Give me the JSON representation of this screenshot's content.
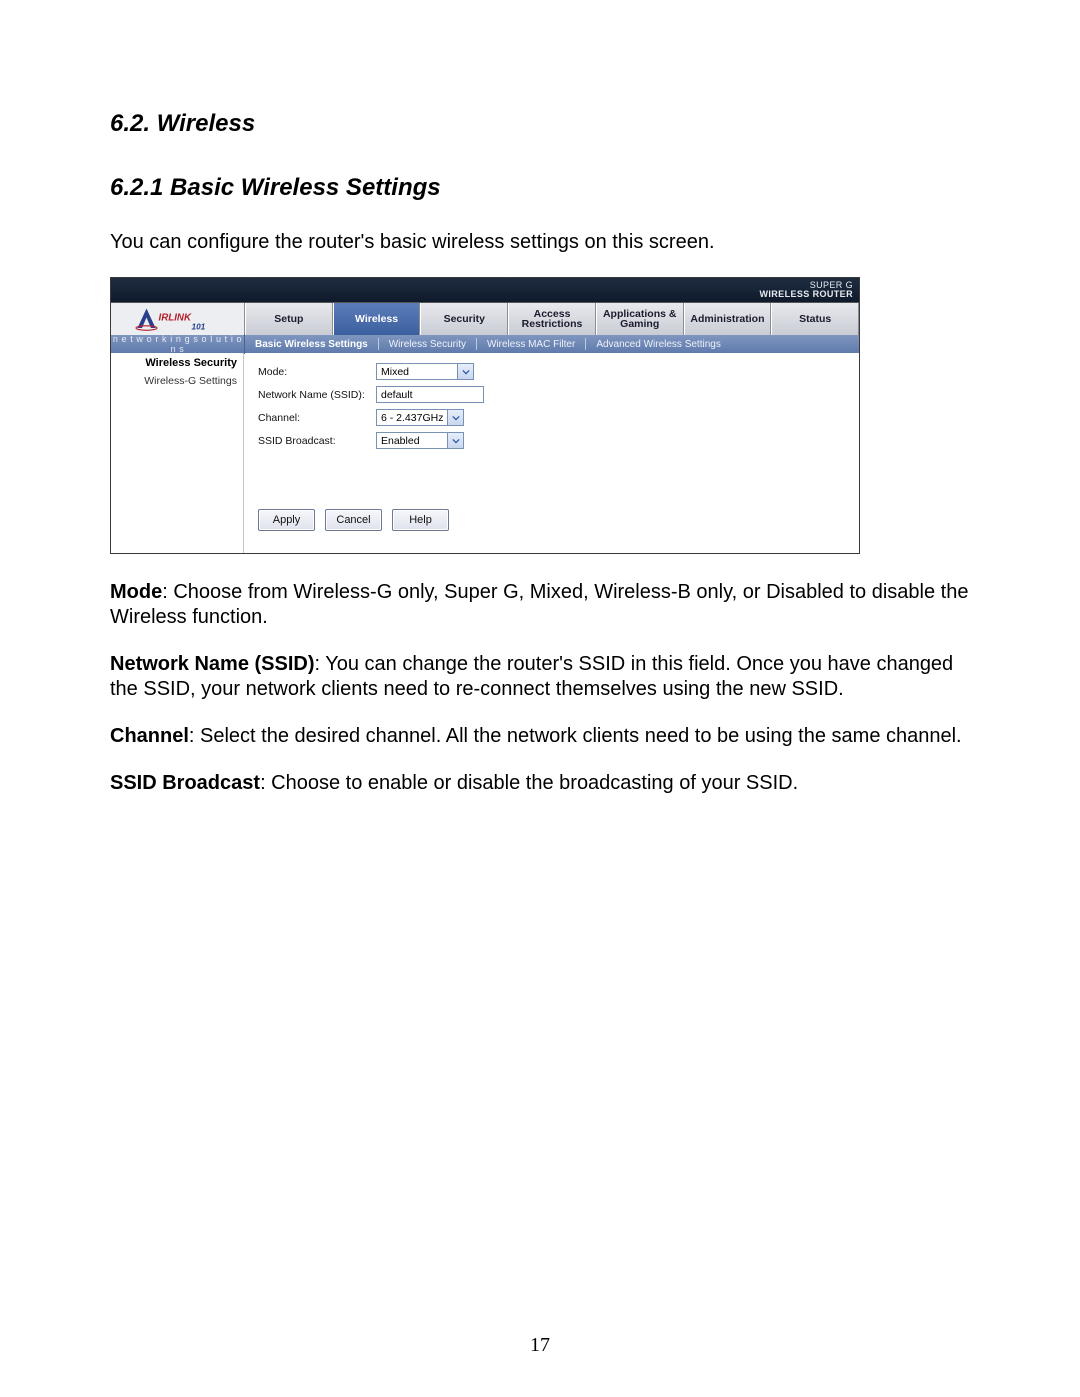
{
  "doc": {
    "h2": "6.2. Wireless",
    "h3": "6.2.1 Basic Wireless Settings",
    "intro": "You can configure the router's basic wireless settings on this screen.",
    "p_mode_label": "Mode",
    "p_mode_text": ": Choose from Wireless-G only, Super G, Mixed, Wireless-B only, or Disabled to disable the Wireless function.",
    "p_ssid_label": "Network Name (SSID)",
    "p_ssid_text": ": You can change the router's SSID in this field. Once you have changed the SSID, your network clients need to re-connect themselves using the new SSID.",
    "p_channel_label": "Channel",
    "p_channel_text": ": Select the desired channel. All the network clients need to be using the same channel.",
    "p_broadcast_label": "SSID Broadcast",
    "p_broadcast_text": ": Choose to enable or disable the broadcasting of your SSID.",
    "page_number": "17"
  },
  "router": {
    "model_line1": "SUPER G",
    "model_line2": "WIRELESS ROUTER",
    "brand_logo_text": "AIRLINK 101",
    "slogan": "n e t w o r k i n g s o l u t i o n s",
    "tabs": {
      "0": "Setup",
      "1": "Wireless",
      "2": "Security",
      "3a": "Access",
      "3b": "Restrictions",
      "4a": "Applications &",
      "4b": "Gaming",
      "5": "Administration",
      "6": "Status"
    },
    "subtabs": {
      "0": "Basic Wireless Settings",
      "1": "Wireless Security",
      "2": "Wireless MAC Filter",
      "3": "Advanced Wireless Settings"
    },
    "sidebar": {
      "heading": "Wireless Security",
      "item": "Wireless-G Settings"
    },
    "form": {
      "mode_label": "Mode:",
      "mode_value": "Mixed",
      "ssid_label": "Network Name (SSID):",
      "ssid_value": "default",
      "channel_label": "Channel:",
      "channel_value": "6 - 2.437GHz",
      "broadcast_label": "SSID Broadcast:",
      "broadcast_value": "Enabled"
    },
    "buttons": {
      "apply": "Apply",
      "cancel": "Cancel",
      "help": "Help"
    }
  }
}
